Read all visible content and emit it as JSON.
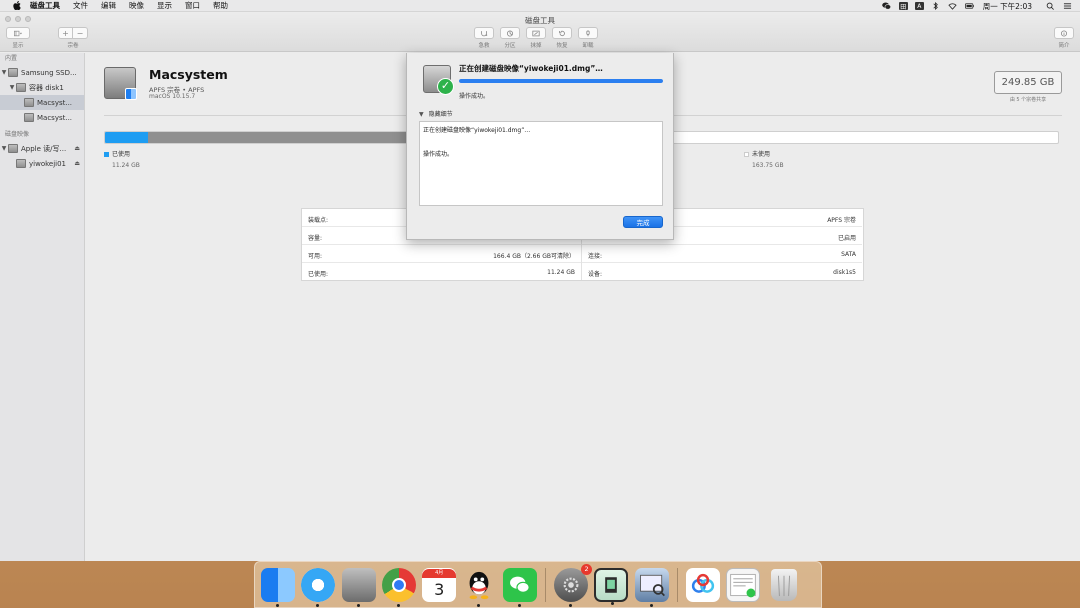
{
  "menubar": {
    "app_name": "磁盘工具",
    "items": [
      "文件",
      "编辑",
      "映像",
      "显示",
      "窗口",
      "帮助"
    ],
    "input_icons": [
      "田",
      "A"
    ],
    "clock": "周一 下午2:03"
  },
  "window": {
    "title": "磁盘工具",
    "toolbar": {
      "view_label": "显示",
      "volume_label": "宗卷",
      "first_aid_label": "急救",
      "partition_label": "分区",
      "erase_label": "抹掉",
      "restore_label": "恢复",
      "mount_label": "卸载",
      "info_label": "简介",
      "add_symbol": "+",
      "remove_symbol": "−"
    }
  },
  "sidebar": {
    "internal_header": "内置",
    "images_header": "磁盘映像",
    "items": [
      {
        "label": "Samsung SSD..."
      },
      {
        "label": "容器 disk1"
      },
      {
        "label": "Macsyst..."
      },
      {
        "label": "Macsyst..."
      },
      {
        "label": "Apple 读/写..."
      },
      {
        "label": "yiwokeji01"
      }
    ]
  },
  "volume": {
    "name": "Macsystem",
    "subtitle": "APFS 宗卷 • APFS",
    "os": "macOS 10.15.7",
    "capacity": "249.85 GB",
    "capacity_note": "由 5 个宗卷共享",
    "used_label": "已使用",
    "used_size": "11.24 GB",
    "free_label": "未使用",
    "free_size": "163.75 GB",
    "used_fraction": 0.045,
    "other_fraction": 0.295
  },
  "info": {
    "left": [
      {
        "key": "装载点:",
        "value": ""
      },
      {
        "key": "容量:",
        "value": ""
      },
      {
        "key": "可用:",
        "value": "166.4 GB（2.66 GB可清除）"
      },
      {
        "key": "已使用:",
        "value": "11.24 GB"
      }
    ],
    "right": [
      {
        "key": "",
        "value": "APFS 宗卷"
      },
      {
        "key": "",
        "value": "已启用"
      },
      {
        "key": "连接:",
        "value": "SATA"
      },
      {
        "key": "设备:",
        "value": "disk1s5"
      }
    ]
  },
  "sheet": {
    "title": "正在创建磁盘映像“yiwokeji01.dmg”…",
    "progress": 1.0,
    "status": "操作成功。",
    "details_toggle": "隐藏细节",
    "log": [
      "正在创建磁盘映像“yiwokeji01.dmg”…",
      "",
      "",
      "操作成功。"
    ],
    "done_button": "完成"
  },
  "dock": {
    "calendar_month": "4月",
    "calendar_day": "3",
    "system_prefs_badge": "2"
  },
  "colors": {
    "accent": "#2b7ff0",
    "used_bar": "#1e9df2",
    "other_bar": "#8f8f8f",
    "success": "#2db24b",
    "badge": "#e7382d"
  }
}
